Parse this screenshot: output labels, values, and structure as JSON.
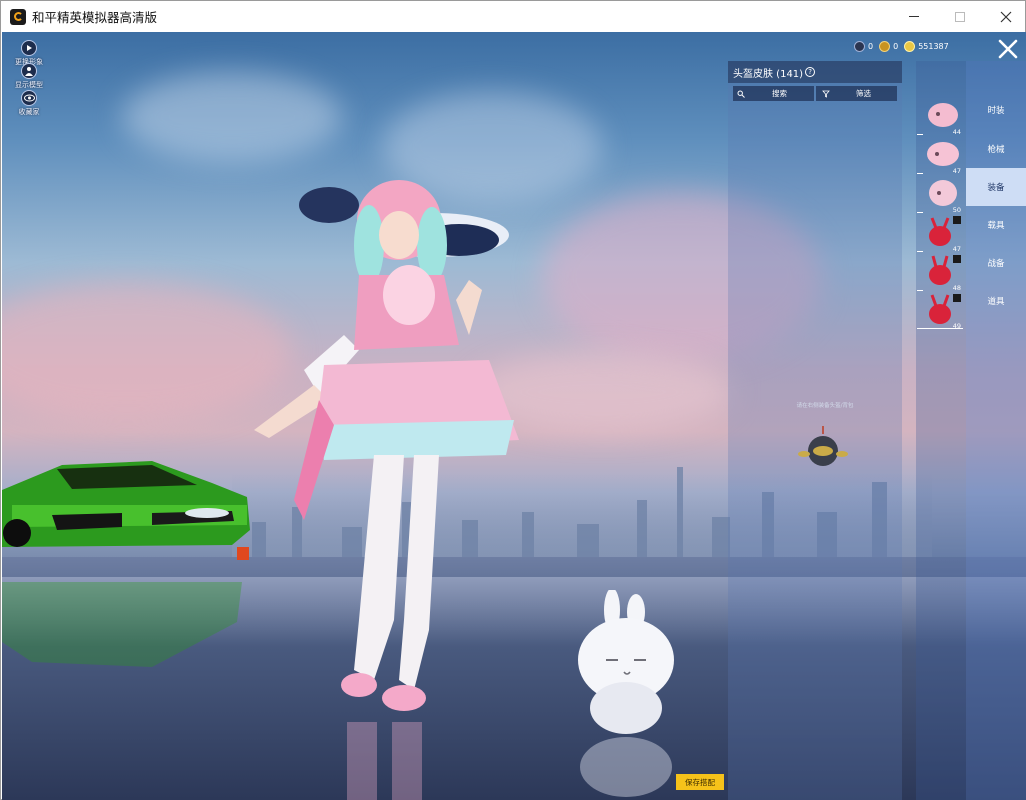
{
  "window": {
    "title": "和平精英模拟器高清版"
  },
  "left_controls": [
    {
      "label": "更换形象",
      "icon": "play-icon"
    },
    {
      "label": "显示模型",
      "icon": "person-icon"
    },
    {
      "label": "收藏家",
      "icon": "eye-icon"
    }
  ],
  "currency": {
    "a": "0",
    "b": "0",
    "coins": "551387"
  },
  "panel": {
    "title": "头盔皮肤 (141)",
    "help": "?",
    "search_label": "搜索",
    "filter_label": "筛选"
  },
  "items": [
    {
      "num": "44"
    },
    {
      "num": "47"
    },
    {
      "num": "50"
    },
    {
      "num": "47"
    },
    {
      "num": "48"
    },
    {
      "num": "49"
    }
  ],
  "tabs": [
    {
      "label": "时装"
    },
    {
      "label": "枪械"
    },
    {
      "label": "装备"
    },
    {
      "label": "载具"
    },
    {
      "label": "战备"
    },
    {
      "label": "道具"
    }
  ],
  "scene": {
    "drone_hint": "请在右侧装备头盔/背包"
  },
  "save_button": "保存搭配",
  "colors": {
    "tab_active_bg": "#d7e4fa",
    "save_button_bg": "#f6c21a"
  }
}
